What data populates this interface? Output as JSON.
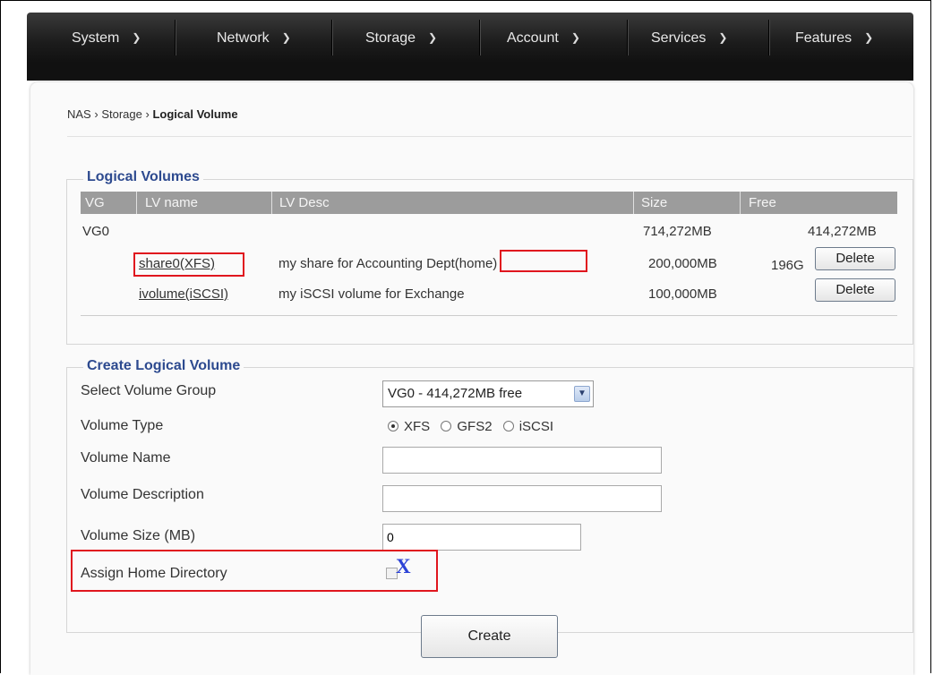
{
  "nav": {
    "items": [
      {
        "label": "System"
      },
      {
        "label": "Network"
      },
      {
        "label": "Storage"
      },
      {
        "label": "Account"
      },
      {
        "label": "Services"
      },
      {
        "label": "Features"
      }
    ]
  },
  "breadcrumb": {
    "nas": "NAS",
    "storage": "Storage",
    "current": "Logical Volume",
    "sep": "›"
  },
  "logical_volumes": {
    "legend": "Logical Volumes",
    "columns": {
      "vg": "VG",
      "lv_name": "LV name",
      "lv_desc": "LV Desc",
      "size": "Size",
      "free": "Free"
    },
    "vg_row": {
      "vg": "VG0",
      "size": "714,272MB",
      "free": "414,272MB"
    },
    "rows": [
      {
        "name": "share0(XFS)",
        "desc": "my share for Accounting Dept(home)",
        "size": "200,000MB",
        "free": "196G",
        "action": "Delete"
      },
      {
        "name": "ivolume(iSCSI)",
        "desc": "my iSCSI volume for Exchange",
        "size": "100,000MB",
        "free": "",
        "action": "Delete"
      }
    ]
  },
  "create": {
    "legend": "Create Logical Volume",
    "select_vg_label": "Select Volume Group",
    "select_vg_value": "VG0 - 414,272MB free",
    "volume_type_label": "Volume Type",
    "volume_type_options": [
      "XFS",
      "GFS2",
      "iSCSI"
    ],
    "volume_type_selected": "XFS",
    "volume_name_label": "Volume Name",
    "volume_name_value": "",
    "volume_desc_label": "Volume Description",
    "volume_desc_value": "",
    "volume_size_label": "Volume Size (MB)",
    "volume_size_value": "0",
    "home_dir_label": "Assign Home Directory",
    "home_dir_mark": "X",
    "create_button": "Create"
  },
  "colors": {
    "legend": "#2d4a8f",
    "highlight": "#e0161e",
    "annotation": "#2d43d6",
    "table_header": "#9c9c9c"
  }
}
